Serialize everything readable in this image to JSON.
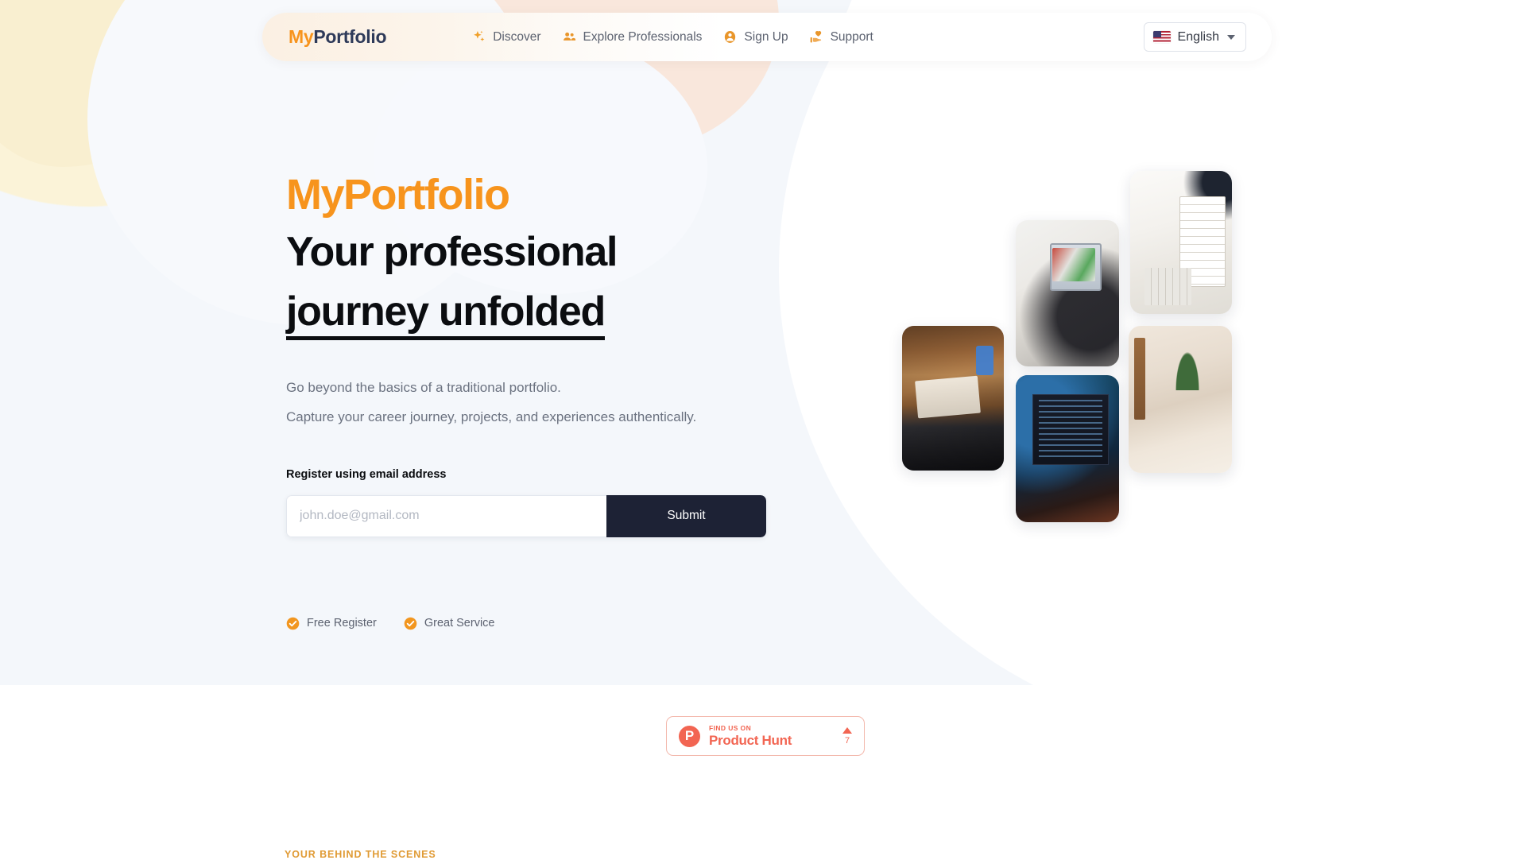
{
  "brand": {
    "prefix": "My",
    "suffix": "Portfolio"
  },
  "nav": {
    "items": [
      {
        "label": "Discover",
        "icon": "sparkle-icon"
      },
      {
        "label": "Explore Professionals",
        "icon": "people-icon"
      },
      {
        "label": "Sign Up",
        "icon": "account-circle-icon"
      },
      {
        "label": "Support",
        "icon": "hand-heart-icon"
      }
    ],
    "language": {
      "label": "English",
      "flag": "us-flag-icon",
      "caret": "chevron-down-icon"
    }
  },
  "hero": {
    "brand_heading": "MyPortfolio",
    "headline_line1": "Your professional",
    "headline_line2": "journey unfolded",
    "subtitle_line1": "Go beyond the basics of a traditional portfolio.",
    "subtitle_line2": "Capture your career journey, projects, and experiences authentically.",
    "form_label": "Register using email address",
    "email_placeholder": "john.doe@gmail.com",
    "email_value": "",
    "submit_label": "Submit",
    "perks": [
      {
        "label": "Free Register",
        "icon": "check-circle-icon"
      },
      {
        "label": "Great Service",
        "icon": "check-circle-icon"
      }
    ]
  },
  "product_hunt": {
    "logo_letter": "P",
    "kicker": "FIND US ON",
    "name": "Product Hunt",
    "upvote_icon": "triangle-up-icon",
    "upvote_count": "7"
  },
  "collage": {
    "photos": [
      {
        "alt": "person-writing-at-desk"
      },
      {
        "alt": "person-working-on-laptop"
      },
      {
        "alt": "hand-writing-in-notebook"
      },
      {
        "alt": "code-editor-on-monitors"
      },
      {
        "alt": "desk-with-plants"
      }
    ]
  },
  "bottom_section": {
    "eyebrow": "YOUR BEHIND THE SCENES"
  },
  "colors": {
    "accent_orange": "#f7941d",
    "navy": "#2e3a59",
    "submit_dark": "#1d2235",
    "product_hunt_red": "#f26552",
    "hero_bg": "#f4f7fb"
  }
}
